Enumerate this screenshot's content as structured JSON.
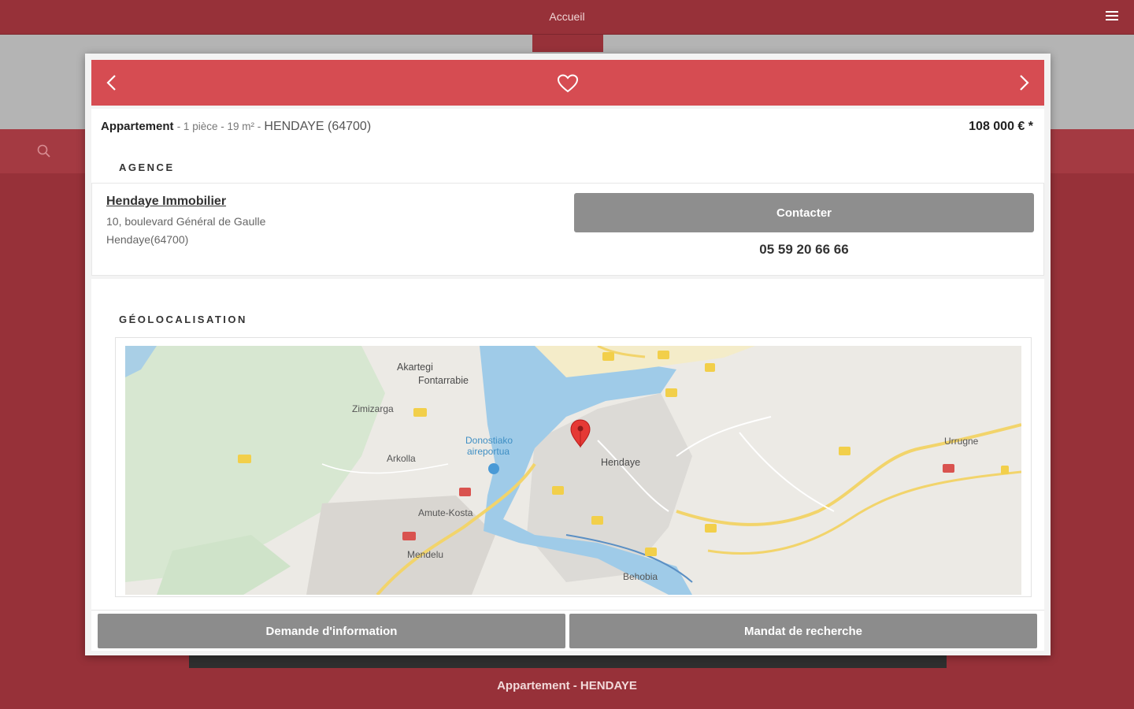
{
  "app": {
    "title": "Accueil",
    "background_caption": "Appartement - HENDAYE"
  },
  "listing": {
    "type": "Appartement",
    "details": "- 1 pièce - 19 m² -",
    "city": "HENDAYE (64700)",
    "price": "108 000 € *"
  },
  "agency": {
    "section_title": "AGENCE",
    "name": "Hendaye Immobilier",
    "address_line1": "10, boulevard Général de Gaulle",
    "address_line2": "Hendaye(64700)",
    "contact_label": "Contacter",
    "phone": "05 59 20 66 66"
  },
  "geo": {
    "section_title": "GÉOLOCALISATION",
    "map_labels": {
      "akartegi": "Akartegi",
      "fontarrabie": "Fontarrabie",
      "zimizarga": "Zimizarga",
      "arkolla": "Arkolla",
      "donostiako": "Donostiako",
      "aireportua": "aireportua",
      "amute": "Amute-Kosta",
      "mendelu": "Mendelu",
      "hendaye": "Hendaye",
      "urrugne": "Urrugne",
      "behobia": "Behobia"
    }
  },
  "actions": {
    "info_label": "Demande d'information",
    "mandat_label": "Mandat de recherche"
  },
  "colors": {
    "brand": "#973139",
    "header": "#d64c52",
    "button": "#8e8e8e",
    "map_water": "#9fcbe8",
    "map_road": "#f2d46b",
    "pin": "#e53935"
  }
}
